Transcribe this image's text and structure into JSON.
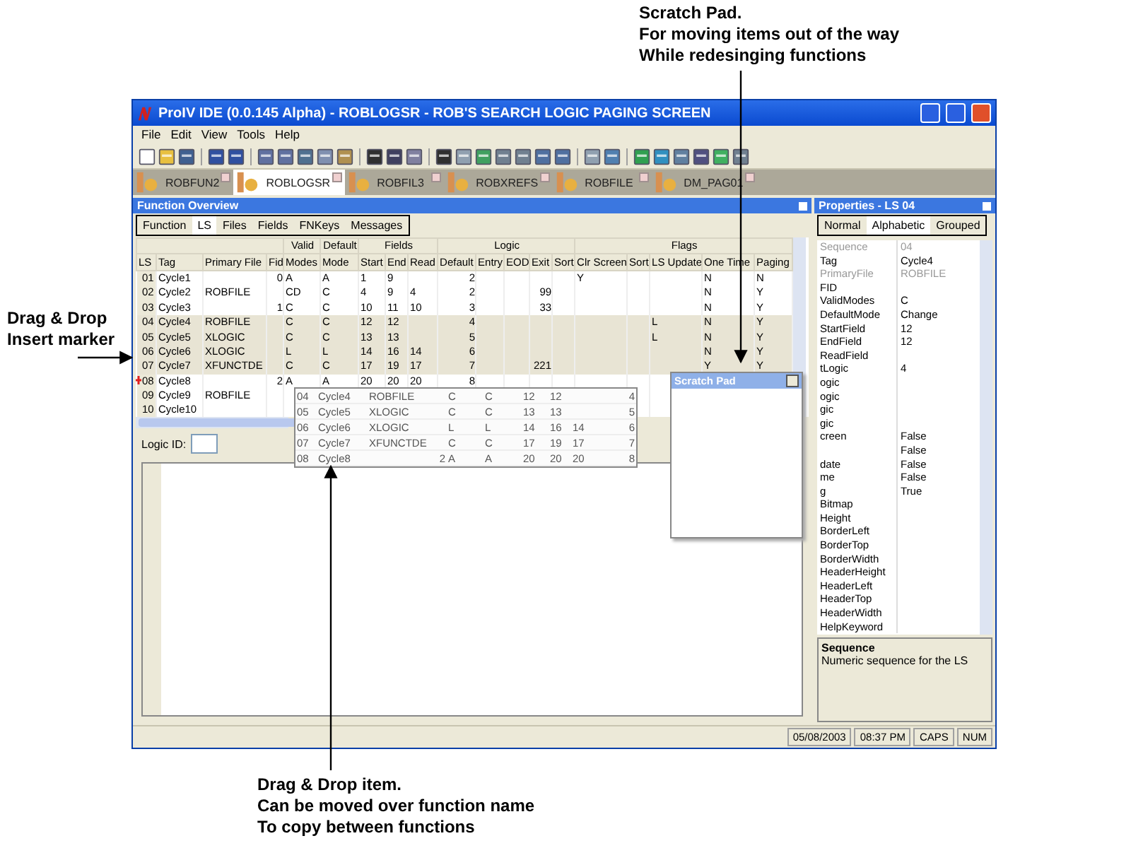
{
  "annotations": [
    {
      "kind": "top",
      "lines": [
        "Scratch Pad.",
        "For moving items out of the way",
        "While redesinging functions"
      ]
    },
    {
      "kind": "left",
      "lines": [
        "Drag & Drop",
        "Insert marker"
      ]
    },
    {
      "kind": "bottom",
      "lines": [
        "Drag & Drop item.",
        "Can be moved over function name",
        "To copy between functions"
      ]
    }
  ],
  "window": {
    "title": "ProIV IDE (0.0.145 Alpha) - ROBLOGSR - ROB'S SEARCH LOGIC PAGING SCREEN"
  },
  "menu": [
    "File",
    "Edit",
    "View",
    "Tools",
    "Help"
  ],
  "doc_tabs": [
    {
      "label": "ROBFUN2",
      "selected": false
    },
    {
      "label": "ROBLOGSR",
      "selected": true
    },
    {
      "label": "ROBFIL3",
      "selected": false
    },
    {
      "label": "ROBXREFS",
      "selected": false
    },
    {
      "label": "ROBFILE",
      "selected": false
    },
    {
      "label": "DM_PAG01",
      "selected": false
    }
  ],
  "function_overview": {
    "title": "Function Overview",
    "tabs": [
      {
        "label": "Function",
        "selected": false
      },
      {
        "label": "LS",
        "selected": true
      },
      {
        "label": "Files",
        "selected": false
      },
      {
        "label": "Fields",
        "selected": false
      },
      {
        "label": "FNKeys",
        "selected": false
      },
      {
        "label": "Messages",
        "selected": false
      }
    ],
    "table": {
      "column_groups": [
        {
          "columns": [
            "LS",
            "Tag",
            "Primary File",
            "Fid"
          ]
        },
        {
          "label": "Valid",
          "columns": [
            "Modes"
          ]
        },
        {
          "label": "Default",
          "columns": [
            "Mode"
          ]
        },
        {
          "label": "Fields",
          "columns": [
            "Start",
            "End",
            "Read"
          ]
        },
        {
          "label": "Logic",
          "columns": [
            "Default",
            "Entry",
            "EOD",
            "Exit",
            "Sort"
          ]
        },
        {
          "label": "Flags",
          "columns": [
            "Clr Screen",
            "Sort",
            "LS Update",
            "One Time",
            "Paging"
          ]
        }
      ],
      "rows": [
        {
          "selected": false,
          "insert_marker": false,
          "cells": [
            "01",
            "Cycle1",
            "",
            "0",
            "A",
            "A",
            "1",
            "9",
            "",
            "2",
            "",
            "",
            "",
            "",
            "Y",
            "",
            "",
            "N",
            "N"
          ]
        },
        {
          "selected": false,
          "insert_marker": false,
          "cells": [
            "02",
            "Cycle2",
            "ROBFILE",
            "",
            "CD",
            "C",
            "4",
            "9",
            "4",
            "2",
            "",
            "",
            "99",
            "",
            "",
            "",
            "",
            "N",
            "Y"
          ]
        },
        {
          "selected": false,
          "insert_marker": false,
          "cells": [
            "03",
            "Cycle3",
            "",
            "1",
            "C",
            "C",
            "10",
            "11",
            "10",
            "3",
            "",
            "",
            "33",
            "",
            "",
            "",
            "",
            "N",
            "Y"
          ]
        },
        {
          "selected": true,
          "insert_marker": false,
          "cells": [
            "04",
            "Cycle4",
            "ROBFILE",
            "",
            "C",
            "C",
            "12",
            "12",
            "",
            "4",
            "",
            "",
            "",
            "",
            "",
            "",
            "L",
            "N",
            "Y"
          ]
        },
        {
          "selected": true,
          "insert_marker": false,
          "cells": [
            "05",
            "Cycle5",
            "XLOGIC",
            "",
            "C",
            "C",
            "13",
            "13",
            "",
            "5",
            "",
            "",
            "",
            "",
            "",
            "",
            "L",
            "N",
            "Y"
          ]
        },
        {
          "selected": true,
          "insert_marker": false,
          "cells": [
            "06",
            "Cycle6",
            "XLOGIC",
            "",
            "L",
            "L",
            "14",
            "16",
            "14",
            "6",
            "",
            "",
            "",
            "",
            "",
            "",
            "",
            "N",
            "Y"
          ]
        },
        {
          "selected": true,
          "insert_marker": false,
          "cells": [
            "07",
            "Cycle7",
            "XFUNCTDE",
            "",
            "C",
            "C",
            "17",
            "19",
            "17",
            "7",
            "",
            "",
            "221",
            "",
            "",
            "",
            "",
            "Y",
            "Y"
          ]
        },
        {
          "selected": false,
          "insert_marker": true,
          "cells": [
            "08",
            "Cycle8",
            "",
            "2",
            "A",
            "A",
            "20",
            "20",
            "20",
            "8"
          ]
        },
        {
          "selected": false,
          "insert_marker": false,
          "cells": [
            "09",
            "Cycle9",
            "ROBFILE"
          ]
        },
        {
          "selected": false,
          "insert_marker": false,
          "cells": [
            "10",
            "Cycle10"
          ]
        }
      ]
    },
    "drag_item": {
      "rows": [
        [
          "04",
          "Cycle4",
          "ROBFILE",
          "",
          "C",
          "C",
          "12",
          "12",
          "",
          "4"
        ],
        [
          "05",
          "Cycle5",
          "XLOGIC",
          "",
          "C",
          "C",
          "13",
          "13",
          "",
          "5"
        ],
        [
          "06",
          "Cycle6",
          "XLOGIC",
          "",
          "L",
          "L",
          "14",
          "16",
          "14",
          "6"
        ],
        [
          "07",
          "Cycle7",
          "XFUNCTDE",
          "",
          "C",
          "C",
          "17",
          "19",
          "17",
          "7"
        ],
        [
          "08",
          "Cycle8",
          "",
          "2",
          "A",
          "A",
          "20",
          "20",
          "20",
          "8"
        ]
      ]
    },
    "logic_id": {
      "label": "Logic ID:"
    }
  },
  "scratch_pad": {
    "title": "Scratch Pad"
  },
  "properties": {
    "title": "Properties - LS 04",
    "tabs": [
      {
        "label": "Normal",
        "selected": false
      },
      {
        "label": "Alphabetic",
        "selected": true
      },
      {
        "label": "Grouped",
        "selected": false
      }
    ],
    "rows": [
      {
        "name": "Sequence",
        "value": "04",
        "disabled": true
      },
      {
        "name": "Tag",
        "value": "Cycle4",
        "disabled": false
      },
      {
        "name": "PrimaryFile",
        "value": "ROBFILE",
        "disabled": true
      },
      {
        "name": "FID",
        "disabled": false
      },
      {
        "name": "ValidModes",
        "value": "C",
        "disabled": false
      },
      {
        "name": "DefaultMode",
        "value": "Change",
        "disabled": false
      },
      {
        "name": "StartField",
        "value": "12",
        "disabled": false
      },
      {
        "name": "EndField",
        "value": "12",
        "disabled": false
      },
      {
        "name": "ReadField",
        "disabled": false
      },
      {
        "name": "tLogic",
        "value": "4",
        "disabled": false
      },
      {
        "name": "ogic",
        "disabled": false
      },
      {
        "name": "ogic",
        "disabled": false
      },
      {
        "name": "gic",
        "disabled": false
      },
      {
        "name": "gic",
        "disabled": false
      },
      {
        "name": "creen",
        "value": "False",
        "disabled": false
      },
      {
        "value": "False",
        "disabled": false
      },
      {
        "name": "date",
        "value": "False",
        "disabled": false
      },
      {
        "name": "me",
        "value": "False",
        "disabled": false
      },
      {
        "name": "g",
        "value": "True",
        "disabled": false
      },
      {
        "name": "Bitmap",
        "disabled": false
      },
      {
        "name": "Height",
        "disabled": false
      },
      {
        "name": "BorderLeft",
        "disabled": false
      },
      {
        "name": "BorderTop",
        "disabled": false
      },
      {
        "name": "BorderWidth",
        "disabled": false
      },
      {
        "name": "HeaderHeight",
        "disabled": false
      },
      {
        "name": "HeaderLeft",
        "disabled": false
      },
      {
        "name": "HeaderTop",
        "disabled": false
      },
      {
        "name": "HeaderWidth",
        "disabled": false
      },
      {
        "name": "HelpKeyword",
        "disabled": false
      }
    ],
    "description": {
      "title": "Sequence",
      "text": "Numeric sequence for the LS"
    }
  },
  "status_bar": [
    "05/08/2003",
    "08:37 PM",
    "CAPS",
    "NUM"
  ]
}
